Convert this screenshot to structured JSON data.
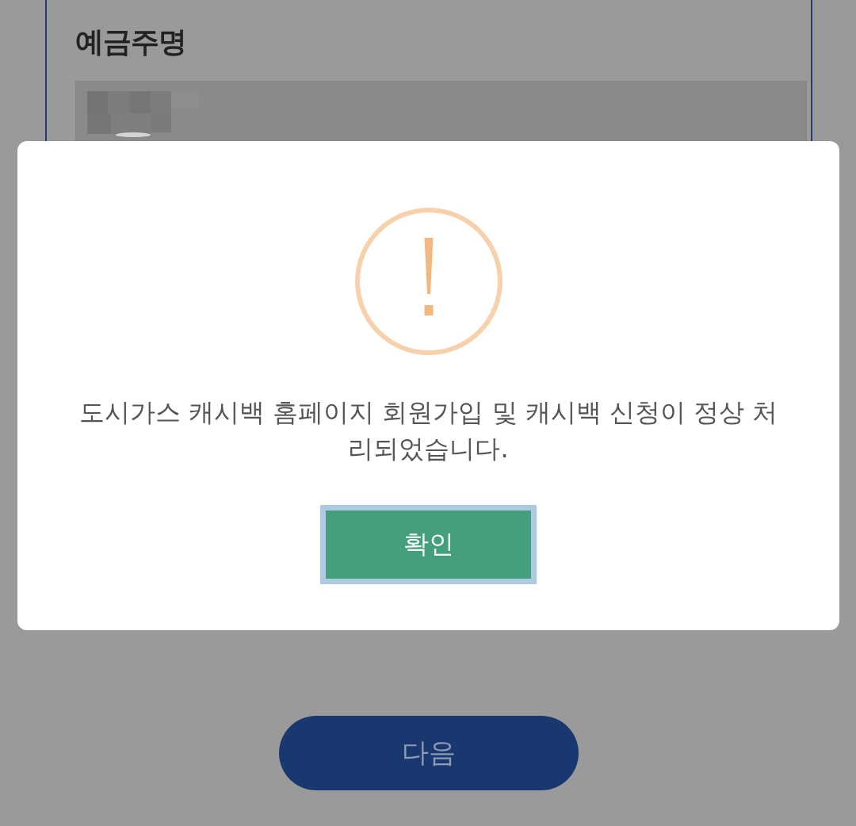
{
  "form": {
    "label": "예금주명",
    "field": {
      "value_redacted": true
    }
  },
  "dialog": {
    "message": "도시가스 캐시백 홈페이지 회원가입 및 캐시백 신청이 정상 처리되었습니다.",
    "confirm_button": {
      "label": "확인",
      "focused": true
    }
  },
  "next_button": {
    "label": "다음"
  }
}
